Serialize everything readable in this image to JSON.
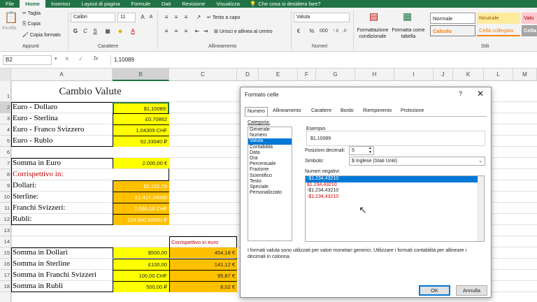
{
  "tabs": {
    "file": "File",
    "home": "Home",
    "insert": "Inserisci",
    "layout": "Layout di pagina",
    "formulas": "Formule",
    "data": "Dati",
    "review": "Revisione",
    "view": "Visualizza",
    "tellme": "Che cosa si desidera fare?"
  },
  "ribbon": {
    "clipboard": {
      "paste": "Incolla",
      "cut": "Taglia",
      "copy": "Copia",
      "format_painter": "Copia formato",
      "label": "Appunti"
    },
    "font": {
      "name": "Calibri",
      "size": "11",
      "bold": "G",
      "italic": "C",
      "underline": "S",
      "label": "Carattere"
    },
    "alignment": {
      "wrap": "Testo a capo",
      "merge": "Unisci e allinea al centro",
      "label": "Allineamento"
    },
    "number": {
      "format": "Valuta",
      "currency": "€",
      "percent": "%",
      "thousands": "000",
      "label": "Numeri"
    },
    "cond": "Formattazione condizionale",
    "table": "Formatta come tabella",
    "styles": {
      "normal": "Normale",
      "neutral": "Neutrale",
      "bad": "Valo",
      "calc": "Calcolo",
      "linked": "Cella collegata",
      "check": "Cella",
      "label": "Stili"
    },
    "colors": {
      "green": "#217346",
      "neutral_bg": "#ffeb9c",
      "neutral_fg": "#9c5700",
      "bad_bg": "#ffc7ce",
      "bad_fg": "#9c0006",
      "calc_fg": "#fa7d00",
      "check_bg": "#a5a5a5"
    }
  },
  "formula_bar": {
    "namebox": "B2",
    "fx": "fx",
    "value": "1,10089"
  },
  "columns": [
    "A",
    "B",
    "C",
    "D",
    "E",
    "F",
    "G",
    "H",
    "I",
    "J",
    "K",
    "L",
    "M"
  ],
  "rows": [
    "1",
    "2",
    "3",
    "4",
    "5",
    "6",
    "7",
    "8",
    "9",
    "10",
    "11",
    "12",
    "13",
    "14",
    "15",
    "16",
    "17",
    "18"
  ],
  "sheet": {
    "title": "Cambio Valute",
    "rates": [
      {
        "label": "Euro - Dollaro",
        "value": "$1,10089"
      },
      {
        "label": "Euro - Sterlina",
        "value": "£0,70862"
      },
      {
        "label": "Euro - Franco Svizzero",
        "value": "1,04309 CHF"
      },
      {
        "label": "Euro - Rublo",
        "value": "62,33040 ₽"
      }
    ],
    "sum_label": "Somma in Euro",
    "sum_value": "2.000,00 €",
    "corr_label": "Corrispettivo in:",
    "converted": [
      {
        "label": "Dollari:",
        "value": "$2.201,78"
      },
      {
        "label": "Sterline:",
        "value": "£1.417,24000"
      },
      {
        "label": "Franchi Svizzeri:",
        "value": "2.086,18 CHF"
      },
      {
        "label": "Rubli:",
        "value": "124.660,80000 ₽"
      }
    ],
    "corr_euro": "Corrispettivo in euro",
    "sums": [
      {
        "label": "Somma in Dollari",
        "value": "$500,00",
        "euro": "454,18 €"
      },
      {
        "label": "Somma in Sterline",
        "value": "£100,00",
        "euro": "141,12 €"
      },
      {
        "label": "Somma in Franchi Svizzeri",
        "value": "100,00 CHF",
        "euro": "95,87 €"
      },
      {
        "label": "Somma in Rubli",
        "value": "500,00 ₽",
        "euro": "8,02 €"
      }
    ],
    "colors": {
      "yellow": "#ffff00",
      "orange": "#ffc000",
      "red_text": "#c00000"
    }
  },
  "dialog": {
    "title": "Formato celle",
    "help": "?",
    "close": "✕",
    "tabs": [
      "Numero",
      "Allineamento",
      "Carattere",
      "Bordo",
      "Riempimento",
      "Protezione"
    ],
    "category_label": "Categoria:",
    "categories": [
      "Generale",
      "Numero",
      "Valuta",
      "Contabilità",
      "Data",
      "Ora",
      "Percentuale",
      "Frazione",
      "Scientifico",
      "Testo",
      "Speciale",
      "Personalizzato"
    ],
    "selected_category": "Valuta",
    "sample_label": "Esempio",
    "sample_value": "$1,10089",
    "decimals_label": "Posizioni decimali:",
    "decimals_value": "5",
    "symbol_label": "Simbolo:",
    "symbol_value": "$ Inglese (Stati Uniti)",
    "negatives_label": "Numeri negativi:",
    "negatives": [
      "-$1.234,43210",
      "$1.234,43210",
      "-$1.234,43210",
      "-$1.234,43210"
    ],
    "description": "I formati valuta sono utilizzati per valori monetari generici. Utilizzare i formati contabilità per allineare i decimali in colonna.",
    "ok": "OK",
    "cancel": "Annulla"
  }
}
